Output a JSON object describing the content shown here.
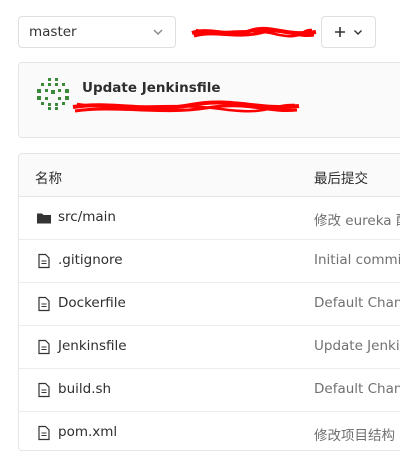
{
  "branch": {
    "selected": "master"
  },
  "commit": {
    "title": "Update Jenkinsfile"
  },
  "table": {
    "headers": {
      "name": "名称",
      "last_commit": "最后提交"
    },
    "rows": [
      {
        "type": "folder",
        "name": "src/main",
        "commit": "修改 eureka 配"
      },
      {
        "type": "file",
        "name": ".gitignore",
        "commit": "Initial commit"
      },
      {
        "type": "file",
        "name": "Dockerfile",
        "commit": "Default Chang"
      },
      {
        "type": "file",
        "name": "Jenkinsfile",
        "commit": "Update Jenkin"
      },
      {
        "type": "file",
        "name": "build.sh",
        "commit": "Default Chang"
      },
      {
        "type": "file",
        "name": "pom.xml",
        "commit": "修改项目结构"
      }
    ]
  },
  "icons": {
    "branch_dropdown": "chevron-down-icon",
    "add": "plus-icon",
    "add_dropdown": "chevron-down-icon",
    "folder": "folder-icon",
    "file": "file-icon",
    "avatar": "identicon-avatar"
  },
  "colors": {
    "redaction": "#ff0000",
    "avatar": "#3a8a3a",
    "muted_text": "#707070"
  }
}
